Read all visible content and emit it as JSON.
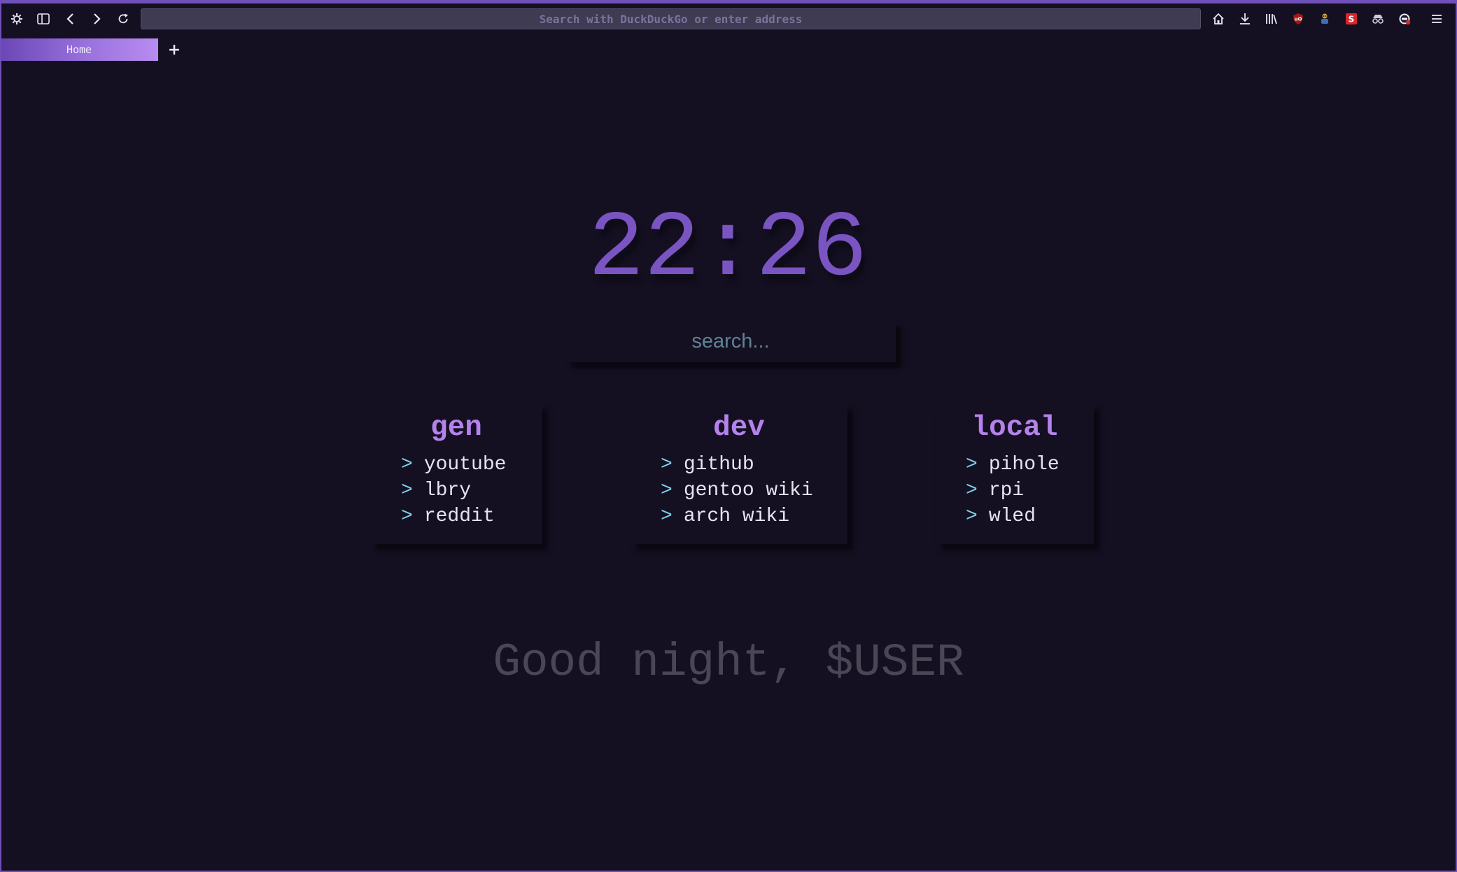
{
  "browser": {
    "url_placeholder": "Search with DuckDuckGo or enter address",
    "tabs": [
      {
        "label": "Home",
        "active": true
      }
    ],
    "new_tab_label": "+",
    "toolbar_icons": [
      "settings-icon",
      "sidebar-icon",
      "back-icon",
      "forward-icon",
      "reload-icon",
      "home-icon",
      "download-icon",
      "library-icon",
      "ublock-icon",
      "extension-icon",
      "s-extension-icon",
      "incognito-icon",
      "privacy-icon",
      "menu-icon"
    ]
  },
  "startpage": {
    "clock": "22:26",
    "search_placeholder": "search...",
    "arrow": ">",
    "cards": [
      {
        "title": "gen",
        "links": [
          "youtube",
          "lbry",
          "reddit"
        ]
      },
      {
        "title": "dev",
        "links": [
          "github",
          "gentoo wiki",
          "arch wiki"
        ]
      },
      {
        "title": "local",
        "links": [
          "pihole",
          "rpi",
          "wled"
        ]
      }
    ],
    "greeting": "Good night, $USER"
  },
  "colors": {
    "background": "#141022",
    "accent": "#7a55c2",
    "card_title": "#b482ea",
    "link_arrow": "#7ed4ee",
    "greeting": "#4a4655"
  }
}
